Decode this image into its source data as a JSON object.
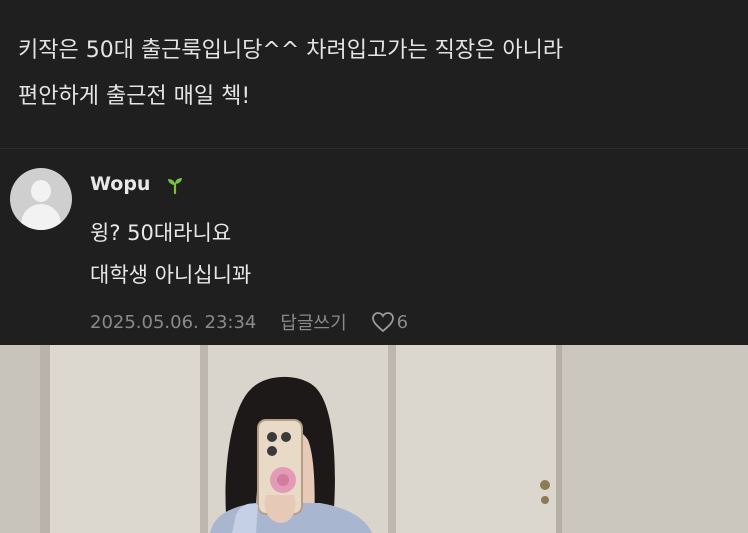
{
  "post": {
    "line1": "키작은 50대 출근룩입니당^^ 차려입고가는 직장은 아니라",
    "line2": "편안하게 출근전 매일 첵!"
  },
  "comment": {
    "username": "Wopu",
    "badge_icon": "sprout-icon",
    "line1": "윙? 50대라니요",
    "line2": "대학생 아니십니꽈",
    "timestamp": "2025.05.06. 23:34",
    "reply_label": "답글쓰기",
    "like_count": "6"
  },
  "colors": {
    "background": "#1f1f1f",
    "text": "#e6e6e6",
    "meta": "#8a8a8a",
    "badge": "#7bc043"
  }
}
